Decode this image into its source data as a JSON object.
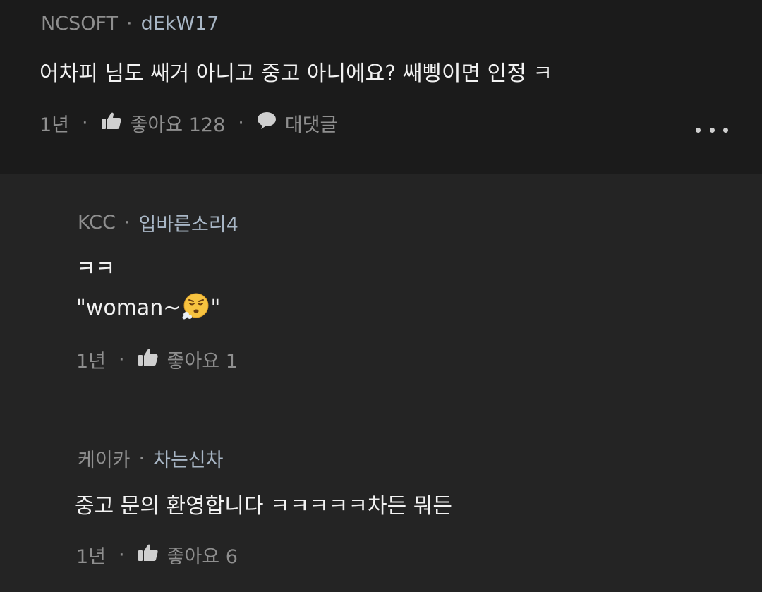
{
  "top_comment": {
    "company": "NCSOFT",
    "separator": "·",
    "nickname": "dEkW17",
    "body": "어차피 님도 쌔거 아니고 중고 아니에요? 쌔삥이면 인정 ㅋ",
    "time": "1년",
    "like_label": "좋아요 128",
    "reply_label": "대댓글",
    "icons": {
      "like": "thumbs-up-icon",
      "reply": "speech-bubble-icon",
      "more": "more-dots-icon"
    }
  },
  "replies": [
    {
      "company": "KCC",
      "separator": "·",
      "nickname": "입바른소리4",
      "body_line1": "ㅋㅋ",
      "body_line2": "\"woman~",
      "body_line2_end": "\"",
      "emoji": "exhaling-face-emoji",
      "time": "1년",
      "like_label": "좋아요 1"
    },
    {
      "company": "케이카",
      "separator": "·",
      "nickname": "차는신차",
      "body": "중고 문의 환영합니다 ㅋㅋㅋㅋㅋ차든 뭐든",
      "time": "1년",
      "like_label": "좋아요 6"
    }
  ],
  "action_separator": "·",
  "colors": {
    "top_background": "#1b1b1b",
    "reply_background": "#242424",
    "text_primary": "#f2f2f2",
    "text_secondary": "#8f8f8f",
    "nickname": "#a9b7c6"
  }
}
